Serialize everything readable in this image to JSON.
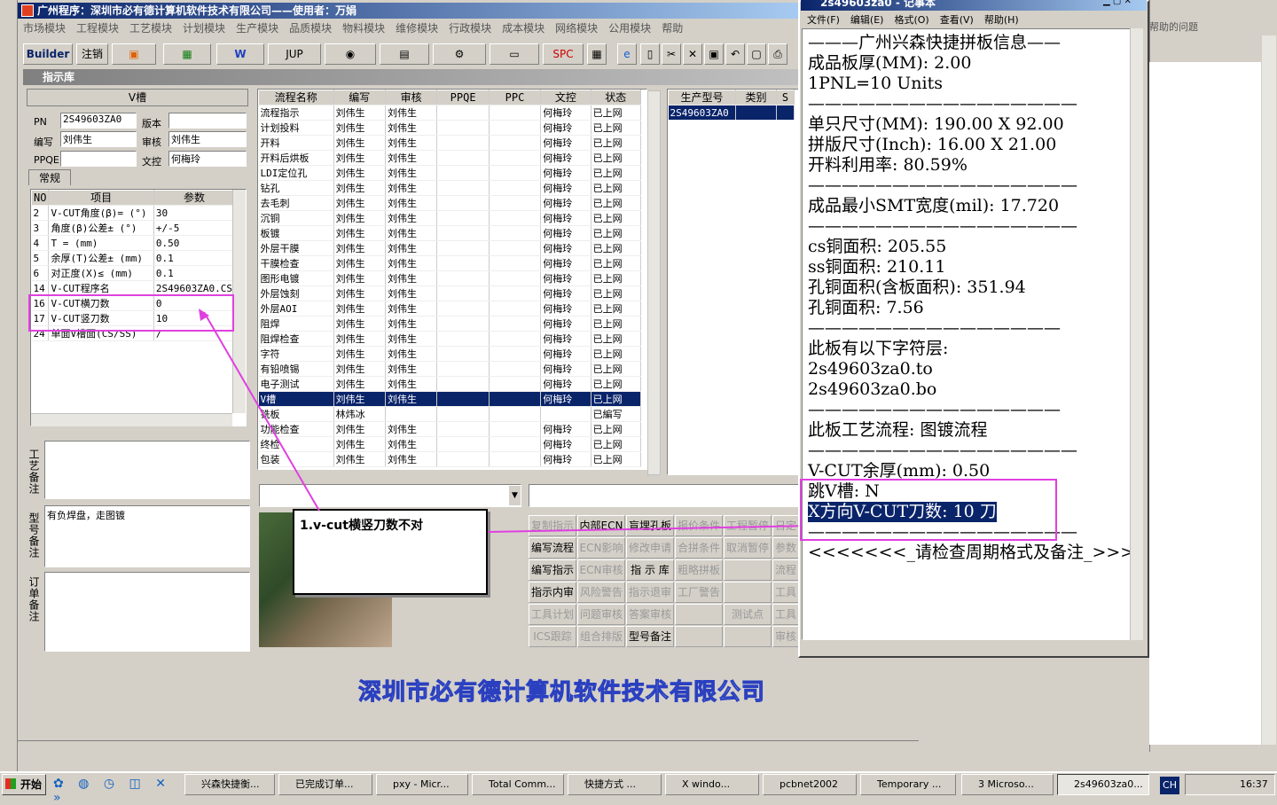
{
  "app": {
    "title": "广州程序：深圳市必有德计算机软件技术有限公司——使用者：万娟",
    "footer_brand": "深圳市必有德计算机软件技术有限公司"
  },
  "menu": [
    "市场模块",
    "工程模块",
    "工艺模块",
    "计划模块",
    "生产模块",
    "品质模块",
    "物料模块",
    "维修模块",
    "行政模块",
    "成本模块",
    "网络模块",
    "公用模块",
    "帮助"
  ],
  "toolbar": {
    "builder": "Builder",
    "logout": "注销",
    "jup": "JUP",
    "spc": "SPC"
  },
  "panel": {
    "title": "指示库",
    "vslot_title": "V槽",
    "fields": {
      "pn_label": "PN",
      "pn": "2S49603ZA0",
      "ver_label": "版本",
      "ver": "",
      "editor_label": "编写",
      "editor": "刘伟生",
      "reviewer_label": "审核",
      "reviewer": "刘伟生",
      "ppqe_label": "PPQE",
      "ppqe": "",
      "doc_label": "文控",
      "doc": "何梅玲"
    },
    "tab": "常规"
  },
  "params": {
    "headers": [
      "NO",
      "项目",
      "参数"
    ],
    "rows": [
      [
        "2",
        "V-CUT角度(β)=  (°)",
        "30"
      ],
      [
        "3",
        "角度(β)公差±  (°)",
        "+/-5"
      ],
      [
        "4",
        "T =  (mm)",
        "0.50"
      ],
      [
        "5",
        "余厚(T)公差±  (mm)",
        "0.1"
      ],
      [
        "6",
        "对正度(X)≤ (mm)",
        "0.1"
      ],
      [
        "14",
        "V-CUT程序名",
        "2S49603ZA0.CS"
      ],
      [
        "16",
        "V-CUT横刀数",
        "0"
      ],
      [
        "17",
        "V-CUT竖刀数",
        "10"
      ],
      [
        "24",
        "单面V槽面(CS/SS)",
        "/"
      ]
    ]
  },
  "notes": {
    "craft_label": "工艺备注",
    "model_label": "型号备注",
    "model_text": "有负焊盘，走图镀",
    "order_label": "订单备注"
  },
  "flow": {
    "headers": [
      "流程名称",
      "编写",
      "审核",
      "PPQE",
      "PPC",
      "文控",
      "状态"
    ],
    "rows": [
      [
        "流程指示",
        "刘伟生",
        "刘伟生",
        "",
        "",
        "何梅玲",
        "已上网"
      ],
      [
        "计划投料",
        "刘伟生",
        "刘伟生",
        "",
        "",
        "何梅玲",
        "已上网"
      ],
      [
        "开料",
        "刘伟生",
        "刘伟生",
        "",
        "",
        "何梅玲",
        "已上网"
      ],
      [
        "开料后烘板",
        "刘伟生",
        "刘伟生",
        "",
        "",
        "何梅玲",
        "已上网"
      ],
      [
        "LDI定位孔",
        "刘伟生",
        "刘伟生",
        "",
        "",
        "何梅玲",
        "已上网"
      ],
      [
        "钻孔",
        "刘伟生",
        "刘伟生",
        "",
        "",
        "何梅玲",
        "已上网"
      ],
      [
        "去毛刺",
        "刘伟生",
        "刘伟生",
        "",
        "",
        "何梅玲",
        "已上网"
      ],
      [
        "沉铜",
        "刘伟生",
        "刘伟生",
        "",
        "",
        "何梅玲",
        "已上网"
      ],
      [
        "板镀",
        "刘伟生",
        "刘伟生",
        "",
        "",
        "何梅玲",
        "已上网"
      ],
      [
        "外层干膜",
        "刘伟生",
        "刘伟生",
        "",
        "",
        "何梅玲",
        "已上网"
      ],
      [
        "干膜检查",
        "刘伟生",
        "刘伟生",
        "",
        "",
        "何梅玲",
        "已上网"
      ],
      [
        "图形电镀",
        "刘伟生",
        "刘伟生",
        "",
        "",
        "何梅玲",
        "已上网"
      ],
      [
        "外层蚀刻",
        "刘伟生",
        "刘伟生",
        "",
        "",
        "何梅玲",
        "已上网"
      ],
      [
        "外层AOI",
        "刘伟生",
        "刘伟生",
        "",
        "",
        "何梅玲",
        "已上网"
      ],
      [
        "阻焊",
        "刘伟生",
        "刘伟生",
        "",
        "",
        "何梅玲",
        "已上网"
      ],
      [
        "阻焊检查",
        "刘伟生",
        "刘伟生",
        "",
        "",
        "何梅玲",
        "已上网"
      ],
      [
        "字符",
        "刘伟生",
        "刘伟生",
        "",
        "",
        "何梅玲",
        "已上网"
      ],
      [
        "有铅喷锡",
        "刘伟生",
        "刘伟生",
        "",
        "",
        "何梅玲",
        "已上网"
      ],
      [
        "电子测试",
        "刘伟生",
        "刘伟生",
        "",
        "",
        "何梅玲",
        "已上网"
      ],
      [
        "V槽",
        "刘伟生",
        "刘伟生",
        "",
        "",
        "何梅玲",
        "已上网"
      ],
      [
        "铣板",
        "林炜冰",
        "",
        "",
        "",
        "",
        "已編写"
      ],
      [
        "功能检查",
        "刘伟生",
        "刘伟生",
        "",
        "",
        "何梅玲",
        "已上网"
      ],
      [
        "终检",
        "刘伟生",
        "刘伟生",
        "",
        "",
        "何梅玲",
        "已上网"
      ],
      [
        "包装",
        "刘伟生",
        "刘伟生",
        "",
        "",
        "何梅玲",
        "已上网"
      ]
    ]
  },
  "models": {
    "headers": [
      "生产型号",
      "类别",
      "S"
    ],
    "rows": [
      [
        "2S49603ZA0"
      ]
    ]
  },
  "buttons": [
    [
      "复制指示",
      "内部ECN",
      "盲埋孔板",
      "报价条件",
      "工程暂停",
      "日定"
    ],
    [
      "编写流程",
      "ECN影响",
      "修改申请",
      "合拼条件",
      "取消暂停",
      "参数"
    ],
    [
      "编写指示",
      "ECN审核",
      "指 示 库",
      "粗略拼板",
      "",
      "流程"
    ],
    [
      "指示内审",
      "风险警告",
      "指示退审",
      "工厂警告",
      "",
      "工具"
    ],
    [
      "工具计划",
      "问题审核",
      "答案审核",
      "",
      "测试点",
      "工具"
    ],
    [
      "ICS跟踪",
      "组合排版",
      "型号备注",
      "",
      "",
      "审核"
    ]
  ],
  "annotation": "1.v-cut横竖刀数不对",
  "notepad": {
    "title": "2s49603za0 - 记事本",
    "menu": [
      "文件(F)",
      "编辑(E)",
      "格式(O)",
      "查看(V)",
      "帮助(H)"
    ],
    "lines": [
      "———广州兴森快捷拼板信息——",
      "成品板厚(MM): 2.00",
      "1PNL=10 Units",
      "————————————————",
      "单只尺寸(MM): 190.00 X 92.00",
      "拼版尺寸(Inch): 16.00 X 21.00",
      "开料利用率: 80.59%",
      "————————————————",
      "成品最小SMT宽度(mil): 17.720",
      "————————————————",
      "cs铜面积: 205.55",
      "ss铜面积: 210.11",
      "孔铜面积(含板面积): 351.94",
      "孔铜面积: 7.56",
      "———————————————",
      "此板有以下字符层:",
      "2s49603za0.to",
      "2s49603za0.bo",
      "———————————————",
      "此板工艺流程: 图镀流程",
      "————————————————",
      "V-CUT余厚(mm): 0.50",
      "跳V槽: N",
      "X方向V-CUT刀数: 10 刀",
      "————————————————",
      "<<<<<<<_请检查周期格式及备注_>>>>>"
    ]
  },
  "word": {
    "help_text": "帮助的问题"
  },
  "taskbar": {
    "start": "开始",
    "items": [
      "兴森快捷衡...",
      "已完成订单...",
      "pxy - Micr...",
      "Total Comm...",
      "快捷方式 ...",
      "X windo...",
      "pcbnet2002",
      "Temporary ...",
      "3 Microso...",
      "2s49603za0..."
    ],
    "lang": "CH",
    "clock": "16:37"
  }
}
